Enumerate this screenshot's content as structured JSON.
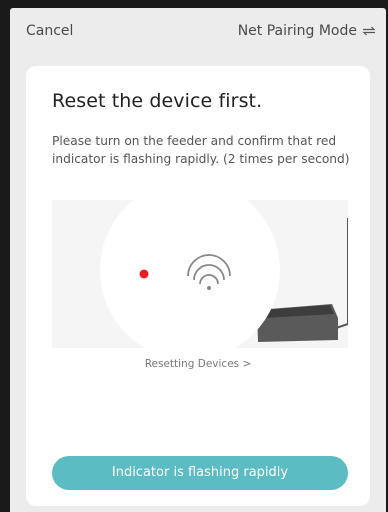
{
  "header": {
    "cancel_label": "Cancel",
    "mode_label": "Net Pairing Mode",
    "mode_icon": "swap-icon"
  },
  "card": {
    "title": "Reset the device first.",
    "description": "Please turn on the feeder and confirm that red indicator is flashing rapidly. (2 times per second)",
    "illustration": {
      "indicator_color": "#ee1c24",
      "icon": "wifi-icon"
    },
    "reset_link_label": "Resetting Devices >",
    "confirm_button_label": "Indicator is flashing rapidly"
  },
  "colors": {
    "accent": "#5bbcc3",
    "background": "#ececec",
    "card": "#ffffff"
  }
}
